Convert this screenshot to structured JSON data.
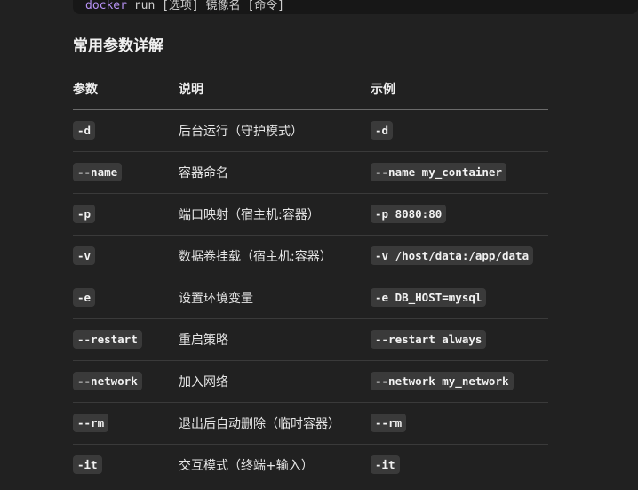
{
  "top_code": {
    "keyword": "docker",
    "rest": " run [选项] 镜像名 [命令]"
  },
  "section_title": "常用参数详解",
  "table": {
    "headers": [
      "参数",
      "说明",
      "示例"
    ],
    "rows": [
      {
        "param": "-d",
        "desc": "后台运行（守护模式）",
        "example": "-d"
      },
      {
        "param": "--name",
        "desc": "容器命名",
        "example": "--name my_container"
      },
      {
        "param": "-p",
        "desc": "端口映射（宿主机:容器）",
        "example": "-p 8080:80"
      },
      {
        "param": "-v",
        "desc": "数据卷挂载（宿主机:容器）",
        "example": "-v /host/data:/app/data"
      },
      {
        "param": "-e",
        "desc": "设置环境变量",
        "example": "-e DB_HOST=mysql"
      },
      {
        "param": "--restart",
        "desc": "重启策略",
        "example": "--restart always"
      },
      {
        "param": "--network",
        "desc": "加入网络",
        "example": "--network my_network"
      },
      {
        "param": "--rm",
        "desc": "退出后自动删除（临时容器）",
        "example": "--rm"
      },
      {
        "param": "-it",
        "desc": "交互模式（终端+输入）",
        "example": "-it"
      }
    ]
  }
}
